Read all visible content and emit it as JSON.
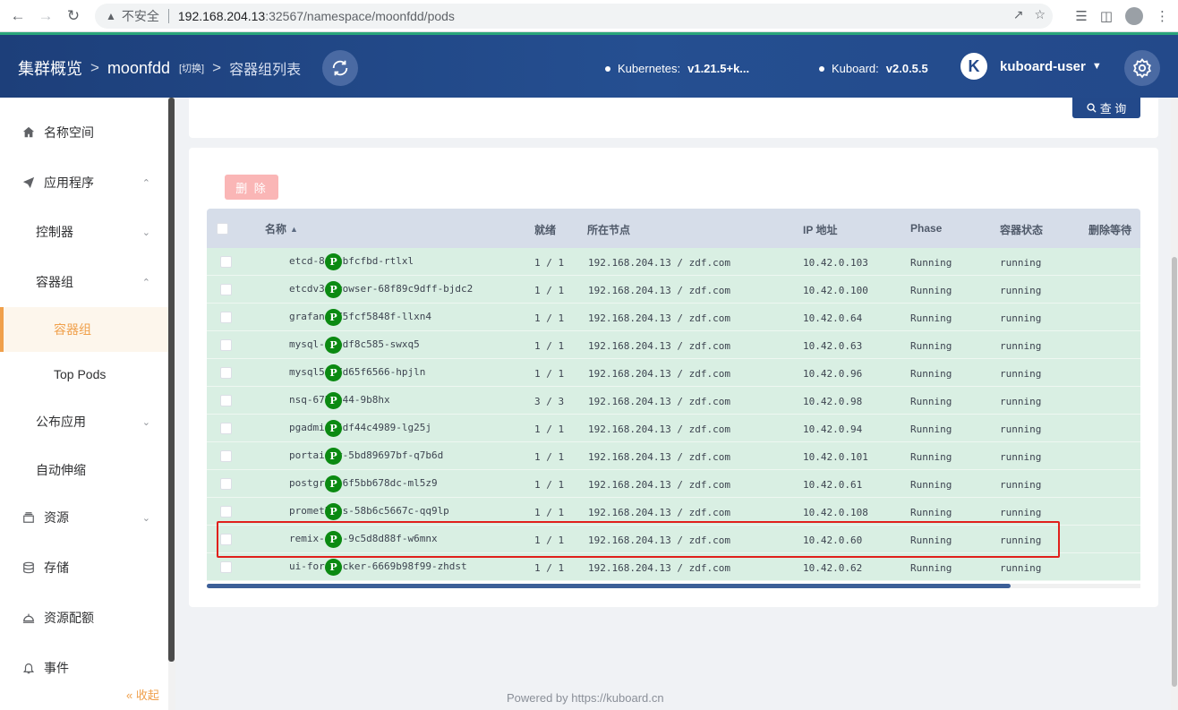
{
  "browser": {
    "insecure_label": "不安全",
    "url_host": "192.168.204.13",
    "url_rest": ":32567/namespace/moonfdd/pods"
  },
  "header": {
    "crumb1": "集群概览",
    "crumb2": "moonfdd",
    "switch_label": "[切换]",
    "crumb3": "容器组列表",
    "kubernetes_label": "Kubernetes:",
    "kubernetes_version": "v1.21.5+k...",
    "kuboard_label": "Kuboard:",
    "kuboard_version": "v2.0.5.5",
    "logo_letter": "K",
    "username": "kuboard-user"
  },
  "sidebar": {
    "items": [
      {
        "label": "名称空间",
        "icon": "home-icon"
      },
      {
        "label": "应用程序",
        "icon": "send-icon"
      },
      {
        "label": "控制器"
      },
      {
        "label": "容器组"
      },
      {
        "label": "容器组"
      },
      {
        "label": "Top Pods"
      },
      {
        "label": "公布应用"
      },
      {
        "label": "自动伸缩"
      },
      {
        "label": "资源",
        "icon": "layers-icon"
      },
      {
        "label": "存储",
        "icon": "database-icon"
      },
      {
        "label": "资源配额",
        "icon": "quota-icon"
      },
      {
        "label": "事件",
        "icon": "bell-icon"
      }
    ],
    "collapse_label": "« 收起"
  },
  "toolbar": {
    "query_label": "查 询",
    "delete_label": "删 除"
  },
  "table": {
    "columns": [
      "名称",
      "就绪",
      "所在节点",
      "IP 地址",
      "Phase",
      "容器状态",
      "删除等待"
    ],
    "phase_badge": "P",
    "rows": [
      {
        "name": "etcd-84dcbfcfbd-rtlxl",
        "ready": "1 / 1",
        "node": "192.168.204.13 / zdf.com",
        "ip": "10.42.0.103",
        "phase": "Running",
        "status": "running"
      },
      {
        "name": "etcdv3-browser-68f89c9dff-bjdc2",
        "ready": "1 / 1",
        "node": "192.168.204.13 / zdf.com",
        "ip": "10.42.0.100",
        "phase": "Running",
        "status": "running"
      },
      {
        "name": "grafana-75fcf5848f-llxn4",
        "ready": "1 / 1",
        "node": "192.168.204.13 / zdf.com",
        "ip": "10.42.0.64",
        "phase": "Running",
        "status": "running"
      },
      {
        "name": "mysql-66bdf8c585-swxq5",
        "ready": "1 / 1",
        "node": "192.168.204.13 / zdf.com",
        "ip": "10.42.0.63",
        "phase": "Running",
        "status": "running"
      },
      {
        "name": "mysql5-57d65f6566-hpjln",
        "ready": "1 / 1",
        "node": "192.168.204.13 / zdf.com",
        "ip": "10.42.0.96",
        "phase": "Running",
        "status": "running"
      },
      {
        "name": "nsq-67b6c44-9b8hx",
        "ready": "3 / 3",
        "node": "192.168.204.13 / zdf.com",
        "ip": "10.42.0.98",
        "phase": "Running",
        "status": "running"
      },
      {
        "name": "pgadmin-5df44c4989-lg25j",
        "ready": "1 / 1",
        "node": "192.168.204.13 / zdf.com",
        "ip": "10.42.0.94",
        "phase": "Running",
        "status": "running"
      },
      {
        "name": "portainer-5bd89697bf-q7b6d",
        "ready": "1 / 1",
        "node": "192.168.204.13 / zdf.com",
        "ip": "10.42.0.101",
        "phase": "Running",
        "status": "running"
      },
      {
        "name": "postgres-6f5bb678dc-ml5z9",
        "ready": "1 / 1",
        "node": "192.168.204.13 / zdf.com",
        "ip": "10.42.0.61",
        "phase": "Running",
        "status": "running"
      },
      {
        "name": "prometheus-58b6c5667c-qq9lp",
        "ready": "1 / 1",
        "node": "192.168.204.13 / zdf.com",
        "ip": "10.42.0.108",
        "phase": "Running",
        "status": "running"
      },
      {
        "name": "remix-ide-9c5d8d88f-w6mnx",
        "ready": "1 / 1",
        "node": "192.168.204.13 / zdf.com",
        "ip": "10.42.0.60",
        "phase": "Running",
        "status": "running"
      },
      {
        "name": "ui-for-docker-6669b98f99-zhdst",
        "ready": "1 / 1",
        "node": "192.168.204.13 / zdf.com",
        "ip": "10.42.0.62",
        "phase": "Running",
        "status": "running"
      }
    ]
  },
  "footer": {
    "powered_label": "Powered by https://kuboard.cn"
  },
  "colors": {
    "header": "#23498a",
    "accent": "#f0a04b",
    "row_bg": "#d9efe3",
    "badge": "#0b8a12",
    "highlight": "#e0201c"
  }
}
